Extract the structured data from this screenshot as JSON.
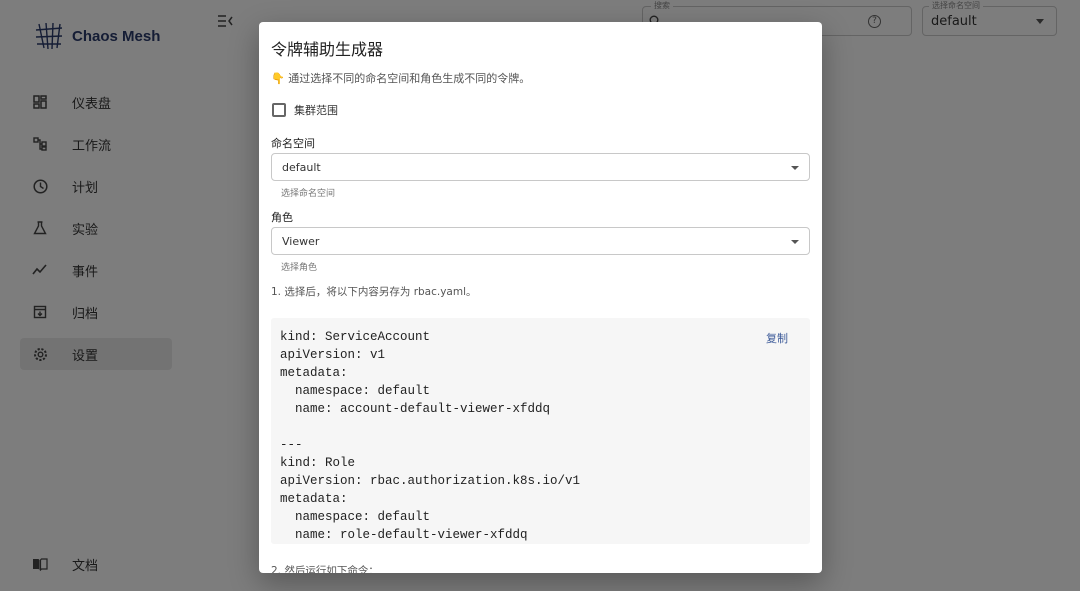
{
  "app": {
    "logo_text": "Chaos Mesh"
  },
  "sidebar": {
    "items": [
      {
        "label": "仪表盘",
        "icon": "dashboard-icon"
      },
      {
        "label": "工作流",
        "icon": "workflow-icon"
      },
      {
        "label": "计划",
        "icon": "clock-icon"
      },
      {
        "label": "实验",
        "icon": "flask-icon"
      },
      {
        "label": "事件",
        "icon": "timeline-icon"
      },
      {
        "label": "归档",
        "icon": "archive-icon"
      },
      {
        "label": "设置",
        "icon": "gear-icon",
        "active": true
      }
    ],
    "docs_label": "文档"
  },
  "topbar": {
    "search_legend": "搜索",
    "search_value": "",
    "namespace_legend": "选择命名空间",
    "namespace_value": "default"
  },
  "dialog": {
    "title": "令牌辅助生成器",
    "description": "👇 通过选择不同的命名空间和角色生成不同的令牌。",
    "cluster_scope_label": "集群范围",
    "cluster_scope_checked": false,
    "namespace_label": "命名空间",
    "namespace_value": "default",
    "namespace_helper": "选择命名空间",
    "role_label": "角色",
    "role_value": "Viewer",
    "role_helper": "选择角色",
    "step1": "1. 选择后，将以下内容另存为 rbac.yaml。",
    "copy_label": "复制",
    "code": "kind: ServiceAccount\napiVersion: v1\nmetadata:\n  namespace: default\n  name: account-default-viewer-xfddq\n\n---\nkind: Role\napiVersion: rbac.authorization.k8s.io/v1\nmetadata:\n  namespace: default\n  name: role-default-viewer-xfddq",
    "step2": "2. 然后运行如下命令："
  }
}
